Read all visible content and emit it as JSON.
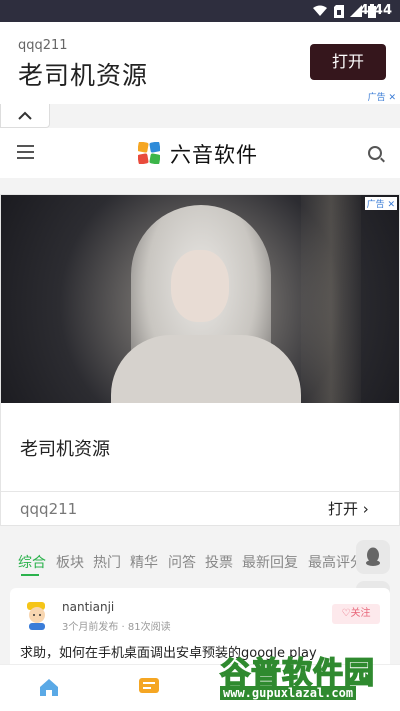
{
  "status_bar": {
    "time": "4:44"
  },
  "top_ad": {
    "subtitle": "qqq211",
    "title": "老司机资源",
    "button_label": "打开",
    "ad_label": "广告"
  },
  "header": {
    "brand": "六音软件"
  },
  "ad_card": {
    "ad_label": "广告",
    "title": "老司机资源",
    "subtitle": "qqq211",
    "open_label": "打开"
  },
  "tabs": [
    {
      "label": "综合",
      "active": true
    },
    {
      "label": "板块"
    },
    {
      "label": "热门"
    },
    {
      "label": "精华"
    },
    {
      "label": "问答"
    },
    {
      "label": "投票"
    },
    {
      "label": "最新回复"
    },
    {
      "label": "最高评分"
    }
  ],
  "post": {
    "author": "nantianji",
    "time": "3个月前发布",
    "views": "81次阅读",
    "follow_label": "关注",
    "text": "求助，如何在手机桌面调出安卓预装的google play"
  },
  "watermark": {
    "title": "谷普软件园",
    "url": "www.gupuxlazal.com"
  },
  "colors": {
    "accent_green": "#2bb24c",
    "ad_button": "#35161c",
    "follow_pink": "#e8677a"
  }
}
